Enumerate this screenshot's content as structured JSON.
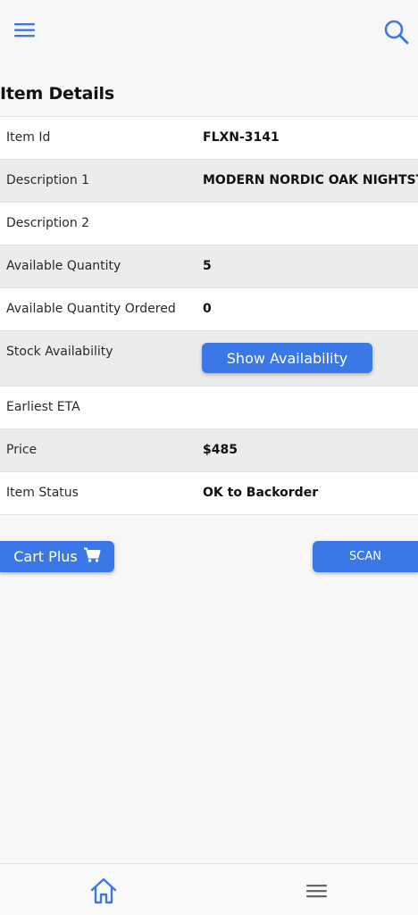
{
  "header": {
    "menu_icon": "hamburger-menu-icon",
    "search_icon": "search-icon",
    "accent": "#3b78e7"
  },
  "page_title": "Item Details",
  "details": [
    {
      "label": "Item Id",
      "value": "FLXN-3141"
    },
    {
      "label": "Description 1",
      "value": "MODERN NORDIC OAK NIGHTSTANI"
    },
    {
      "label": "Description 2",
      "value": ""
    },
    {
      "label": "Available Quantity",
      "value": "5"
    },
    {
      "label": "Available Quantity Ordered",
      "value": "0"
    },
    {
      "label": "Stock Availability",
      "button_label": "Show Availability"
    },
    {
      "label": "Earliest ETA",
      "value": ""
    },
    {
      "label": "Price",
      "value": "$485"
    },
    {
      "label": "Item Status",
      "value": "OK to Backorder"
    }
  ],
  "actions": {
    "cart_plus_label": "Cart Plus",
    "cart_icon": "shopping-cart-icon",
    "scan_label": "SCAN"
  },
  "bottom_nav": {
    "home_icon": "home-icon",
    "menu_icon": "menu-lines-icon"
  }
}
